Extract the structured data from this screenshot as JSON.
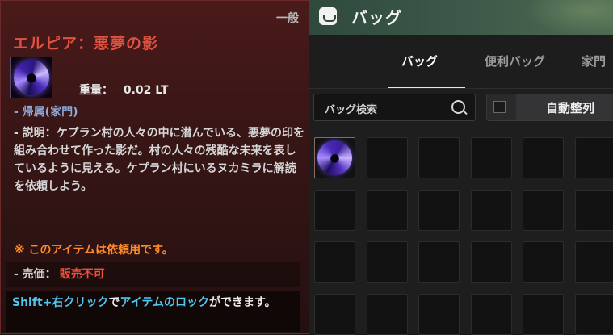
{
  "tooltip": {
    "grade": "一般",
    "item_name": "エルピア：悪夢の影",
    "item_icon": "nightmare-shadow-orb-icon",
    "weight_label": "重量：",
    "weight_value": "0.02 LT",
    "belong": "- 帰属(家門)",
    "description": "- 説明：ケプラン村の人々の中に潜んでいる、悪夢の印を組み合わせて作った影だ。村の人々の残酷な未来を表しているように見える。ケプラン村にいるヌカミラに解読を依頼しよう。",
    "request_note": "※ このアイテムは依頼用です。",
    "price_label": "- 売価：",
    "price_value": "販売不可",
    "hint": {
      "shift_click": "Shift+右クリック",
      "de": "で",
      "lock_item": "アイテムのロック",
      "rest": "ができます。"
    }
  },
  "bag": {
    "title": "バッグ",
    "icon": "bag-icon",
    "tabs": [
      {
        "label": "バッグ",
        "active": true
      },
      {
        "label": "便利バッグ",
        "active": false
      },
      {
        "label": "家門",
        "active": false
      }
    ],
    "search_placeholder": "バッグ検索",
    "auto_sort_label": "自動整列",
    "auto_sort_checked": false,
    "grid_rows": 4,
    "grid_cols": 6,
    "slots": [
      {
        "item": "nightmare-shadow-orb-icon"
      }
    ]
  },
  "colors": {
    "item_name": "#e0513f",
    "tooltip_bg": "#3a1616",
    "bag_header": "#3d5a4a",
    "request_note": "#ff8a2a",
    "hint_cyan": "#4fc6ee"
  }
}
